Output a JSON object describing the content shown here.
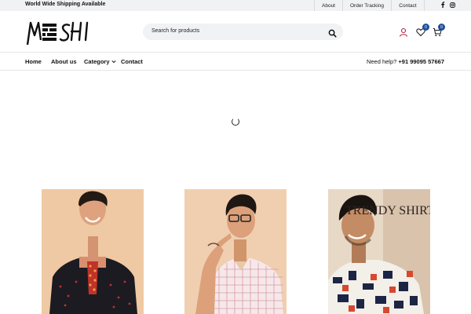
{
  "topbar": {
    "shipping_text": "World Wide Shipping Available",
    "links": [
      "About",
      "Order Tracking",
      "Contact"
    ],
    "social_icons": [
      "facebook-icon",
      "instagram-icon"
    ]
  },
  "header": {
    "search_placeholder": "Search for products",
    "wishlist_count": "0",
    "cart_count": "0"
  },
  "nav": {
    "items": [
      "Home",
      "About us",
      "Category",
      "Contact"
    ],
    "help_label": "Need help? ",
    "help_phone": "+91 99095 57667"
  },
  "banner": {
    "text": "TRENDY SHIRTS"
  },
  "colors": {
    "badge": "#1d4e9b",
    "account_icon": "#b0203a",
    "topbar_bg": "#f1f2f4"
  }
}
